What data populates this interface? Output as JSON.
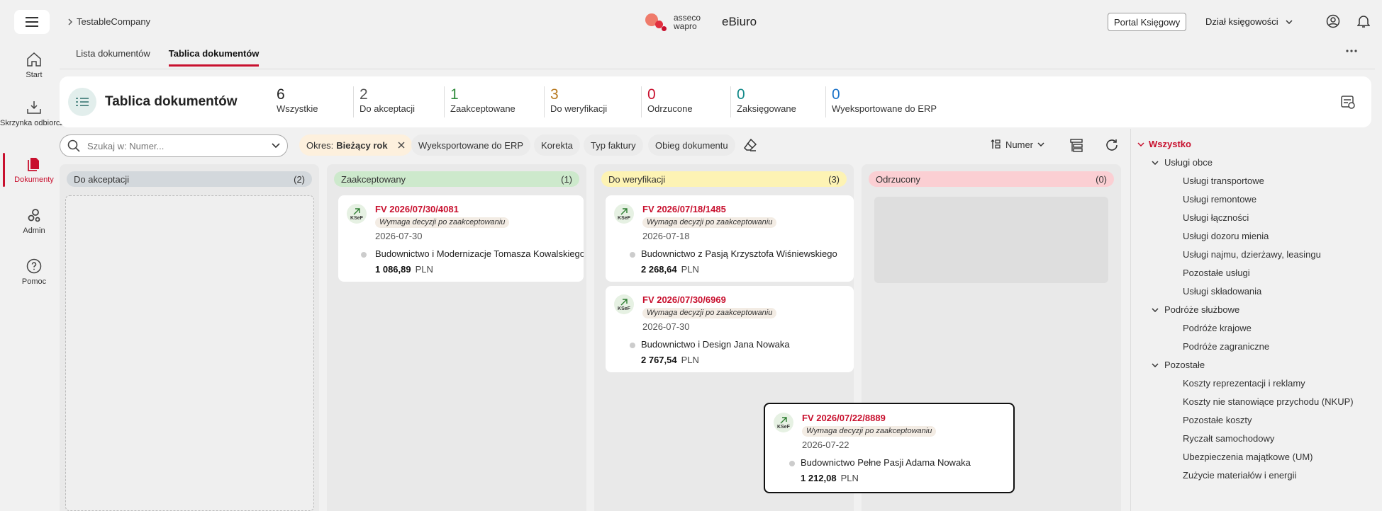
{
  "header": {
    "breadcrumb": "TestableCompany",
    "brand_line1": "asseco",
    "brand_line2": "wapro",
    "app_name": "eBiuro",
    "portal_button": "Portal Księgowy",
    "department": "Dział księgowości",
    "icons": [
      "menu-icon",
      "chevron-right-icon",
      "chevron-down-icon",
      "user-icon",
      "bell-icon"
    ]
  },
  "sidebar": {
    "items": [
      {
        "label": "Start",
        "icon": "home-icon"
      },
      {
        "label": "Skrzynka odbiorcza",
        "icon": "inbox-icon"
      },
      {
        "label": "Dokumenty",
        "icon": "documents-icon",
        "active": true
      },
      {
        "label": "Admin",
        "icon": "gears-icon"
      },
      {
        "label": "Pomoc",
        "icon": "help-icon"
      }
    ]
  },
  "tabs": [
    {
      "label": "Lista dokumentów",
      "active": false
    },
    {
      "label": "Tablica dokumentów",
      "active": true
    }
  ],
  "summary": {
    "title": "Tablica dokumentów",
    "stats": [
      {
        "value": "6",
        "label": "Wszystkie",
        "color": "#222222"
      },
      {
        "value": "2",
        "label": "Do akceptacji",
        "color": "#555555"
      },
      {
        "value": "1",
        "label": "Zaakceptowane",
        "color": "#2e8b3a"
      },
      {
        "value": "3",
        "label": "Do weryfikacji",
        "color": "#b7791f"
      },
      {
        "value": "0",
        "label": "Odrzucone",
        "color": "#c8102e"
      },
      {
        "value": "0",
        "label": "Zaksięgowane",
        "color": "#148a8a"
      },
      {
        "value": "0",
        "label": "Wyeksportowane do ERP",
        "color": "#1e74c9"
      }
    ]
  },
  "filters": {
    "search_placeholder": "Szukaj w: Numer...",
    "period_label": "Okres:",
    "period_value": "Bieżący rok",
    "chips": [
      "Wyeksportowane do ERP",
      "Korekta",
      "Typ faktury",
      "Obieg dokumentu"
    ],
    "sort_label": "Numer"
  },
  "columns": [
    {
      "title": "Do akceptacji",
      "count": "(2)",
      "color": "#d3d8dc"
    },
    {
      "title": "Zaakceptowany",
      "count": "(1)",
      "color": "#cde9cc"
    },
    {
      "title": "Do weryfikacji",
      "count": "(3)",
      "color": "#fdf3b4"
    },
    {
      "title": "Odrzucony",
      "count": "(0)",
      "color": "#fbcfd3"
    }
  ],
  "cards": [
    {
      "number": "FV 2026/07/30/4081",
      "tag": "Wymaga decyzji po zaakceptowaniu",
      "date": "2026-07-30",
      "vendor": "Budownictwo i Modernizacje Tomasza Kowalskiego",
      "amount": "1 086,89",
      "currency": "PLN"
    },
    {
      "number": "FV 2026/07/18/1485",
      "tag": "Wymaga decyzji po zaakceptowaniu",
      "date": "2026-07-18",
      "vendor": "Budownictwo z Pasją Krzysztofa Wiśniewskiego",
      "amount": "2 268,64",
      "currency": "PLN"
    },
    {
      "number": "FV 2026/07/30/6969",
      "tag": "Wymaga decyzji po zaakceptowaniu",
      "date": "2026-07-30",
      "vendor": "Budownictwo i Design Jana Nowaka",
      "amount": "2 767,54",
      "currency": "PLN"
    },
    {
      "number": "FV 2026/07/22/8889",
      "tag": "Wymaga decyzji po zaakceptowaniu",
      "date": "2026-07-22",
      "vendor": "Budownictwo Pełne Pasji Adama Nowaka",
      "amount": "1 212,08",
      "currency": "PLN"
    }
  ],
  "ksef_label": "KSeF",
  "tree": {
    "root": "Wszystko",
    "groups": [
      {
        "label": "Usługi obce",
        "children": [
          "Usługi transportowe",
          "Usługi remontowe",
          "Usługi łączności",
          "Usługi dozoru mienia",
          "Usługi najmu, dzierżawy, leasingu",
          "Pozostałe usługi",
          "Usługi składowania"
        ]
      },
      {
        "label": "Podróże służbowe",
        "children": [
          "Podróże krajowe",
          "Podróże zagraniczne"
        ]
      },
      {
        "label": "Pozostałe",
        "children": [
          "Koszty reprezentacji i reklamy",
          "Koszty nie stanowiące przychodu (NKUP)",
          "Pozostałe koszty",
          "Ryczałt samochodowy",
          "Ubezpieczenia majątkowe (UM)",
          "Zużycie materiałów i energii"
        ]
      }
    ]
  }
}
